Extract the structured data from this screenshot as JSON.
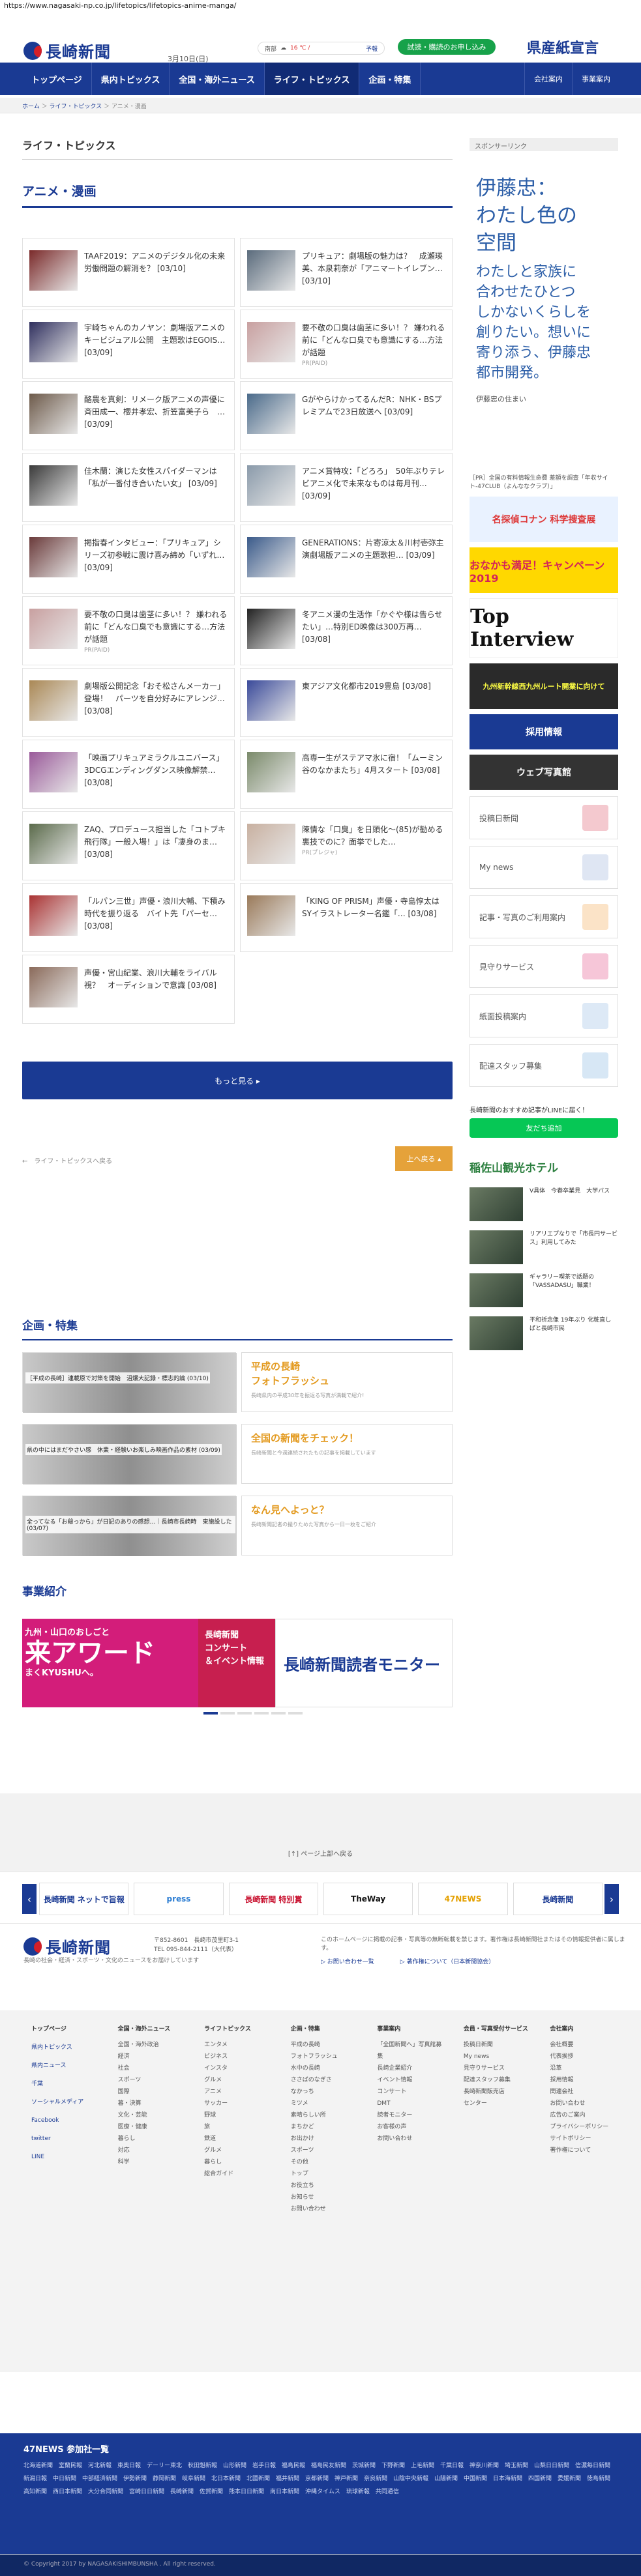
{
  "url": "https://www.nagasaki-np.co.jp/lifetopics/lifetopics-anime-manga/",
  "header": {
    "logo_text": "長崎新聞",
    "date": "3月10日(日)",
    "weather_place": "南部",
    "weather_temp": "16 ℃ /",
    "weather_link": "予報",
    "trial_button": "試読・購読のお申し込み",
    "promo": "県産紙宣言"
  },
  "nav": {
    "items": [
      "トップページ",
      "県内トピックス",
      "全国・海外ニュース",
      "ライフ・トピックス",
      "企画・特集"
    ],
    "right": [
      "会社案内",
      "事業案内"
    ]
  },
  "breadcrumb": {
    "home": "ホーム",
    "mid": "ライフ・トピックス",
    "current": "アニメ・漫画"
  },
  "page_heading": "ライフ・トピックス",
  "section_title": "アニメ・漫画",
  "articles": [
    {
      "text": "TAAF2019：アニメのデジタル化の未来　労働問題の解消を？",
      "date": "[03/10]"
    },
    {
      "text": "プリキュア：劇場版の魅力は？　成瀬瑛美、本泉莉奈が「アニマートイレブン…",
      "date": "[03/10]"
    },
    {
      "text": "宇崎ちゃんのカノヤン：劇場版アニメのキービジュアル公開　主題歌はEGOIS…",
      "date": "[03/09]"
    },
    {
      "text": "要不敬の口臭は歯茎に多い！？ 嫌われる前に「どんな口臭でも意識にする…方法が話題",
      "date": "",
      "sub": "PR(PAID)"
    },
    {
      "text": "酪農を真剣：リメーク版アニメの声優に斉田成一、櫻井孝宏、折笠富美子ら　…",
      "date": "[03/09]"
    },
    {
      "text": "GがやらけかってるんだR：NHK・BSプレミアムで23日放送へ",
      "date": "[03/09]"
    },
    {
      "text": "佳木蘭：演じた女性スパイダーマンは「私が一番付き合いたい女」",
      "date": "[03/09]"
    },
    {
      "text": "アニメ賞特攻：「どろろ」　50年ぶりテレビアニメ化で未来なものは毎月刊…",
      "date": "[03/09]"
    },
    {
      "text": "掲指春インタビュー：「プリキュア」シリーズ初参戦に震け喜み締め「いずれ…",
      "date": "[03/09]"
    },
    {
      "text": "GENERATIONS：片寄涼太＆川村壱弥主演劇場版アニメの主題歌担…",
      "date": "[03/09]"
    },
    {
      "text": "要不敬の口臭は歯茎に多い！？ 嫌われる前に「どんな口臭でも意識にする…方法が話題",
      "date": "",
      "sub": "PR(PAID)"
    },
    {
      "text": "冬アニメ漫の生活作「かぐや様は告らせたい」…特別ED映像は300万再…",
      "date": "[03/08]"
    },
    {
      "text": "劇場版公開記念「おそ松さんメーカー」登場！　パーツを自分好みにアレンジ…",
      "date": "[03/08]"
    },
    {
      "text": "東アジア文化都市2019豊島",
      "date": "[03/08]"
    },
    {
      "text": "「映画プリキュアミラクルユニバース」3DCGエンディングダンス映像解禁…",
      "date": "[03/08]"
    },
    {
      "text": "高専一生がステアマ氷に宿！「ムーミン谷のなかまたち」4月スタート",
      "date": "[03/08]"
    },
    {
      "text": "ZAQ、プロデュース担当した「コトブキ飛行隊」一般入場！」は「凄身のま…",
      "date": "[03/08]"
    },
    {
      "text": "陳情な「口臭」を日頭化〜(85)が勧める裏技でのに？面挙でした…",
      "date": "",
      "sub": "PR(プレジャ)"
    },
    {
      "text": "「ルパン三世」声優・浪川大輔、下積み時代を振り返る　バイト先「パーセ…",
      "date": "[03/08]"
    },
    {
      "text": "「KING OF PRISM」声優・寺島惇太はSYイラストレーター名鑑「…",
      "date": "[03/08]"
    },
    {
      "text": "声優・宮山紀業、浪川大輔をライバル視？　オーディションで意識",
      "date": "[03/08]"
    }
  ],
  "more_button": "もっと見る ▸",
  "pager": {
    "back": "←　ライフ・トピックスへ戻る",
    "up": "上へ戻る ▴"
  },
  "features": {
    "title": "企画・特集",
    "items": [
      {
        "caption": "［平成の長崎］連載原で対策を開始　沼爆大記録・標志的論",
        "date": "(03/10)",
        "title": "平成の長崎\nフォトフラッシュ",
        "desc": "長崎県内の平成30年を振返る写真が満載で紹介!"
      },
      {
        "caption": "県の中にはまだやさい感　休業・経験いお楽しみ映画作品の素材",
        "date": "(03/09)",
        "title": "全国の新聞をチェック！",
        "desc": "長崎新聞と今週連続されたもの記事を掲載しています"
      },
      {
        "caption": "全ってなる「お爺っから」が日記のありの感想…｜長崎市長崎時　東施設した",
        "date": "(03/07)",
        "title": "なん見へよっと？",
        "desc": "長崎新聞記者の撮りためた写真から一日一枚をご紹介"
      }
    ]
  },
  "business": {
    "title": "事業紹介",
    "banner1_small": "九州・山口のおしごと",
    "banner1": "来アワード",
    "banner1_sub": "まくKYUSHUへ。",
    "banner2": "長崎新聞\nコンサート\n＆イベント情報",
    "banner3": "長崎新聞読者モニター"
  },
  "sidebar": {
    "label": "スポンサーリンク",
    "ad_main": "伊藤忠：\nわたし色の\n空間",
    "ad_sub": "わたしと家族に\n合わせたひとつ\nしかないくらしを\n創りたい。想いに\n寄り添う、伊藤忠\n都市開発。",
    "ad_foot": "伊藤忠の住まい",
    "pr_text": "［PR］全国の有料情報生命費 差額を調査「年収サイト-47CLUB（よんななクラブ）」",
    "banners": [
      "名探偵コナン 科学捜査展",
      "おなかも満足！キャンペーン2019",
      "Top Interview",
      "九州新幹線西九州ルート開業に向けて",
      "採用情報",
      "ウェブ写真館"
    ],
    "boxes": [
      "投稿日新聞",
      "My news",
      "記事・写真のご利用案内",
      "見守りサービス",
      "紙面投稿案内",
      "配達スタッフ募集"
    ],
    "line_text": "長崎新聞のおすすめ記事がLINEに届く！",
    "line_button": "友だち追加",
    "hotel": "稲佐山観光ホテル",
    "videos": [
      {
        "text": "V具体　今春卒業見　大学バス"
      },
      {
        "text": "リアリエプなりで「市長円サービス」利用してみた"
      },
      {
        "text": "ギャラリー喫茶で話題の「VASSADASU」職業！"
      },
      {
        "text": "平和祈念像 19年ぶり 化粧直し　ぱと長崎市民"
      }
    ]
  },
  "footer": {
    "to_top": "[↑] ページ上部へ戻る",
    "carousel": [
      "長崎新聞 ネットで旨報",
      "press",
      "長崎新聞 特別賞",
      "TheWay",
      "47NEWS",
      "長崎新聞"
    ],
    "logo_text": "長崎新聞",
    "address1": "〒852-8601　長崎市茂里町3-1",
    "address2": "TEL 095-844-2111（大代表）",
    "desc": "長崎の社会・経済・スポーツ・文化のニュースをお届けしています",
    "note": "このホームページに掲載の記事・写真等の無断転載を禁じます。著作権は長崎新聞社またはその情報提供者に属します。",
    "links": [
      "▷ お問い合わせ一覧",
      "▷ 著作権について（日本新聞協会）"
    ],
    "columns": [
      {
        "head": "トップページ",
        "links": [],
        "extra": [
          "県内トピックス",
          "県内ニュース",
          "千葉",
          "ソーシャルメディア",
          "Facebook",
          "twitter",
          "LINE"
        ]
      },
      {
        "head": "全国・海外ニュース",
        "links": [
          "全国・海外政治",
          "経済",
          "社会",
          "スポーツ",
          "国際",
          "暮・決算",
          "文化・芸能",
          "医療・健康",
          "暮らし",
          "対応",
          "科学"
        ]
      },
      {
        "head": "ライフトピックス",
        "links": [
          "エンタメ",
          "ビジネス",
          "インスタ",
          "グルメ",
          "アニメ",
          "サッカー",
          "野球",
          "旅",
          "鉄道",
          "グルメ",
          "暮らし",
          "総合ガイド"
        ]
      },
      {
        "head": "企画・特集",
        "links": [
          "平成の長崎",
          "フォトフラッシュ",
          "水中の長崎",
          "ささばのなぎさ",
          "なかっち",
          "ミツメ",
          "素晴らしい所",
          "まちかど",
          "お出かけ",
          "スポーツ",
          "その他",
          "トップ",
          "お役立ち",
          "お知らせ",
          "お問い合わせ"
        ]
      },
      {
        "head": "事業案内",
        "links": [
          "「全国新聞へ」写真館募集",
          "長崎企業紹介",
          "イベント情報",
          "コンサート",
          "DMT",
          "読者モニター",
          "お客様の声",
          "お問い合わせ"
        ]
      },
      {
        "head": "会員・写真受付サービス",
        "links": [
          "投稿日新聞",
          "My news",
          "見守りサービス",
          "配達スタッフ募集",
          "長崎新聞販売店",
          "センター"
        ]
      },
      {
        "head": "会社案内",
        "links": [
          "会社概要",
          "代表挨拶",
          "沿革",
          "採用情報",
          "関連会社",
          "お問い合わせ",
          "広告のご案内",
          "プライバシーポリシー",
          "サイトポリシー",
          "著作権について"
        ]
      }
    ],
    "n47_title": "47NEWS 参加社一覧",
    "n47_list": "北海道新聞　室蘭民報　河北新報　東奥日報　デーリー東北　秋田魁新報　山形新聞　岩手日報　福島民報　福島民友新聞　茨城新聞　下野新聞　上毛新聞　千葉日報　神奈川新聞　埼玉新聞　山梨日日新聞　信濃毎日新聞　新潟日報　中日新聞　中部経済新聞　伊勢新聞　静岡新聞　岐阜新聞　北日本新聞　北國新聞　福井新聞　京都新聞　神戸新聞　奈良新聞　山陰中央新報　山陽新聞　中国新聞　日本海新聞　四国新聞　愛媛新聞　徳島新聞　高知新聞　西日本新聞　大分合同新聞　宮崎日日新聞　長崎新聞　佐賀新聞　熊本日日新聞　南日本新聞　沖縄タイムス　琉球新報　共同通信",
    "copyright": "© Copyright 2017 by NAGASAKISHIMBUNSHA . All right reserved."
  }
}
